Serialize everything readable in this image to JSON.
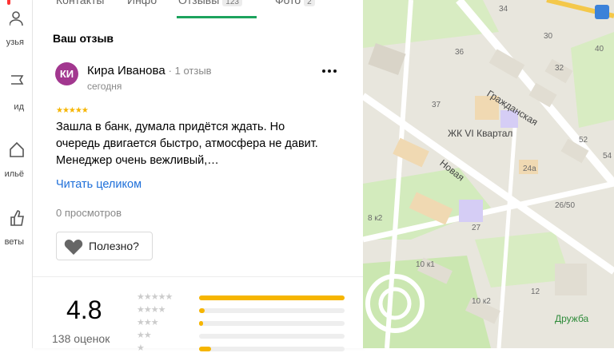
{
  "nav": {
    "items": [
      {
        "label": "узья",
        "icon": "people-icon"
      },
      {
        "label": "ид",
        "icon": "flag-icon"
      },
      {
        "label": "ильё",
        "icon": "house-icon"
      },
      {
        "label": "веты",
        "icon": "thumb-up-icon"
      }
    ]
  },
  "tabs": [
    {
      "label": "Контакты"
    },
    {
      "label": "Инфо"
    },
    {
      "label": "Отзывы",
      "badge": "123"
    },
    {
      "label": "Фото",
      "badge": "2"
    }
  ],
  "review": {
    "section_title": "Ваш отзыв",
    "avatar_initials": "КИ",
    "author": "Кира Иванова",
    "author_count": "· 1 отзыв",
    "date": "сегодня",
    "stars": "★★★★★",
    "rating": 5,
    "text": "Зашла в банк, думала придётся ждать. Но очередь двигается быстро, атмосфера не давит. Менеджер очень вежливый,…",
    "read_more": "Читать целиком",
    "views": "0 просмотров",
    "helpful_label": "Полезно?"
  },
  "rating_summary": {
    "score": "4.8",
    "total": "138 оценок",
    "distribution": [
      {
        "stars": "★★★★★",
        "fraction": 1.0
      },
      {
        "stars": "★★★★",
        "fraction": 0.04
      },
      {
        "stars": "★★★",
        "fraction": 0.03
      },
      {
        "stars": "★★",
        "fraction": 0.0
      },
      {
        "stars": "★",
        "fraction": 0.08
      }
    ]
  },
  "map": {
    "streets": [
      "Гражданская",
      "Новая"
    ],
    "place_labels": [
      "ЖК VI Квартал",
      "Дружба"
    ],
    "house_numbers": [
      "34",
      "30",
      "36",
      "32",
      "37",
      "52",
      "54",
      "24а",
      "26/50",
      "8 к2",
      "27",
      "10 к1",
      "10 к2",
      "12",
      "40"
    ]
  }
}
